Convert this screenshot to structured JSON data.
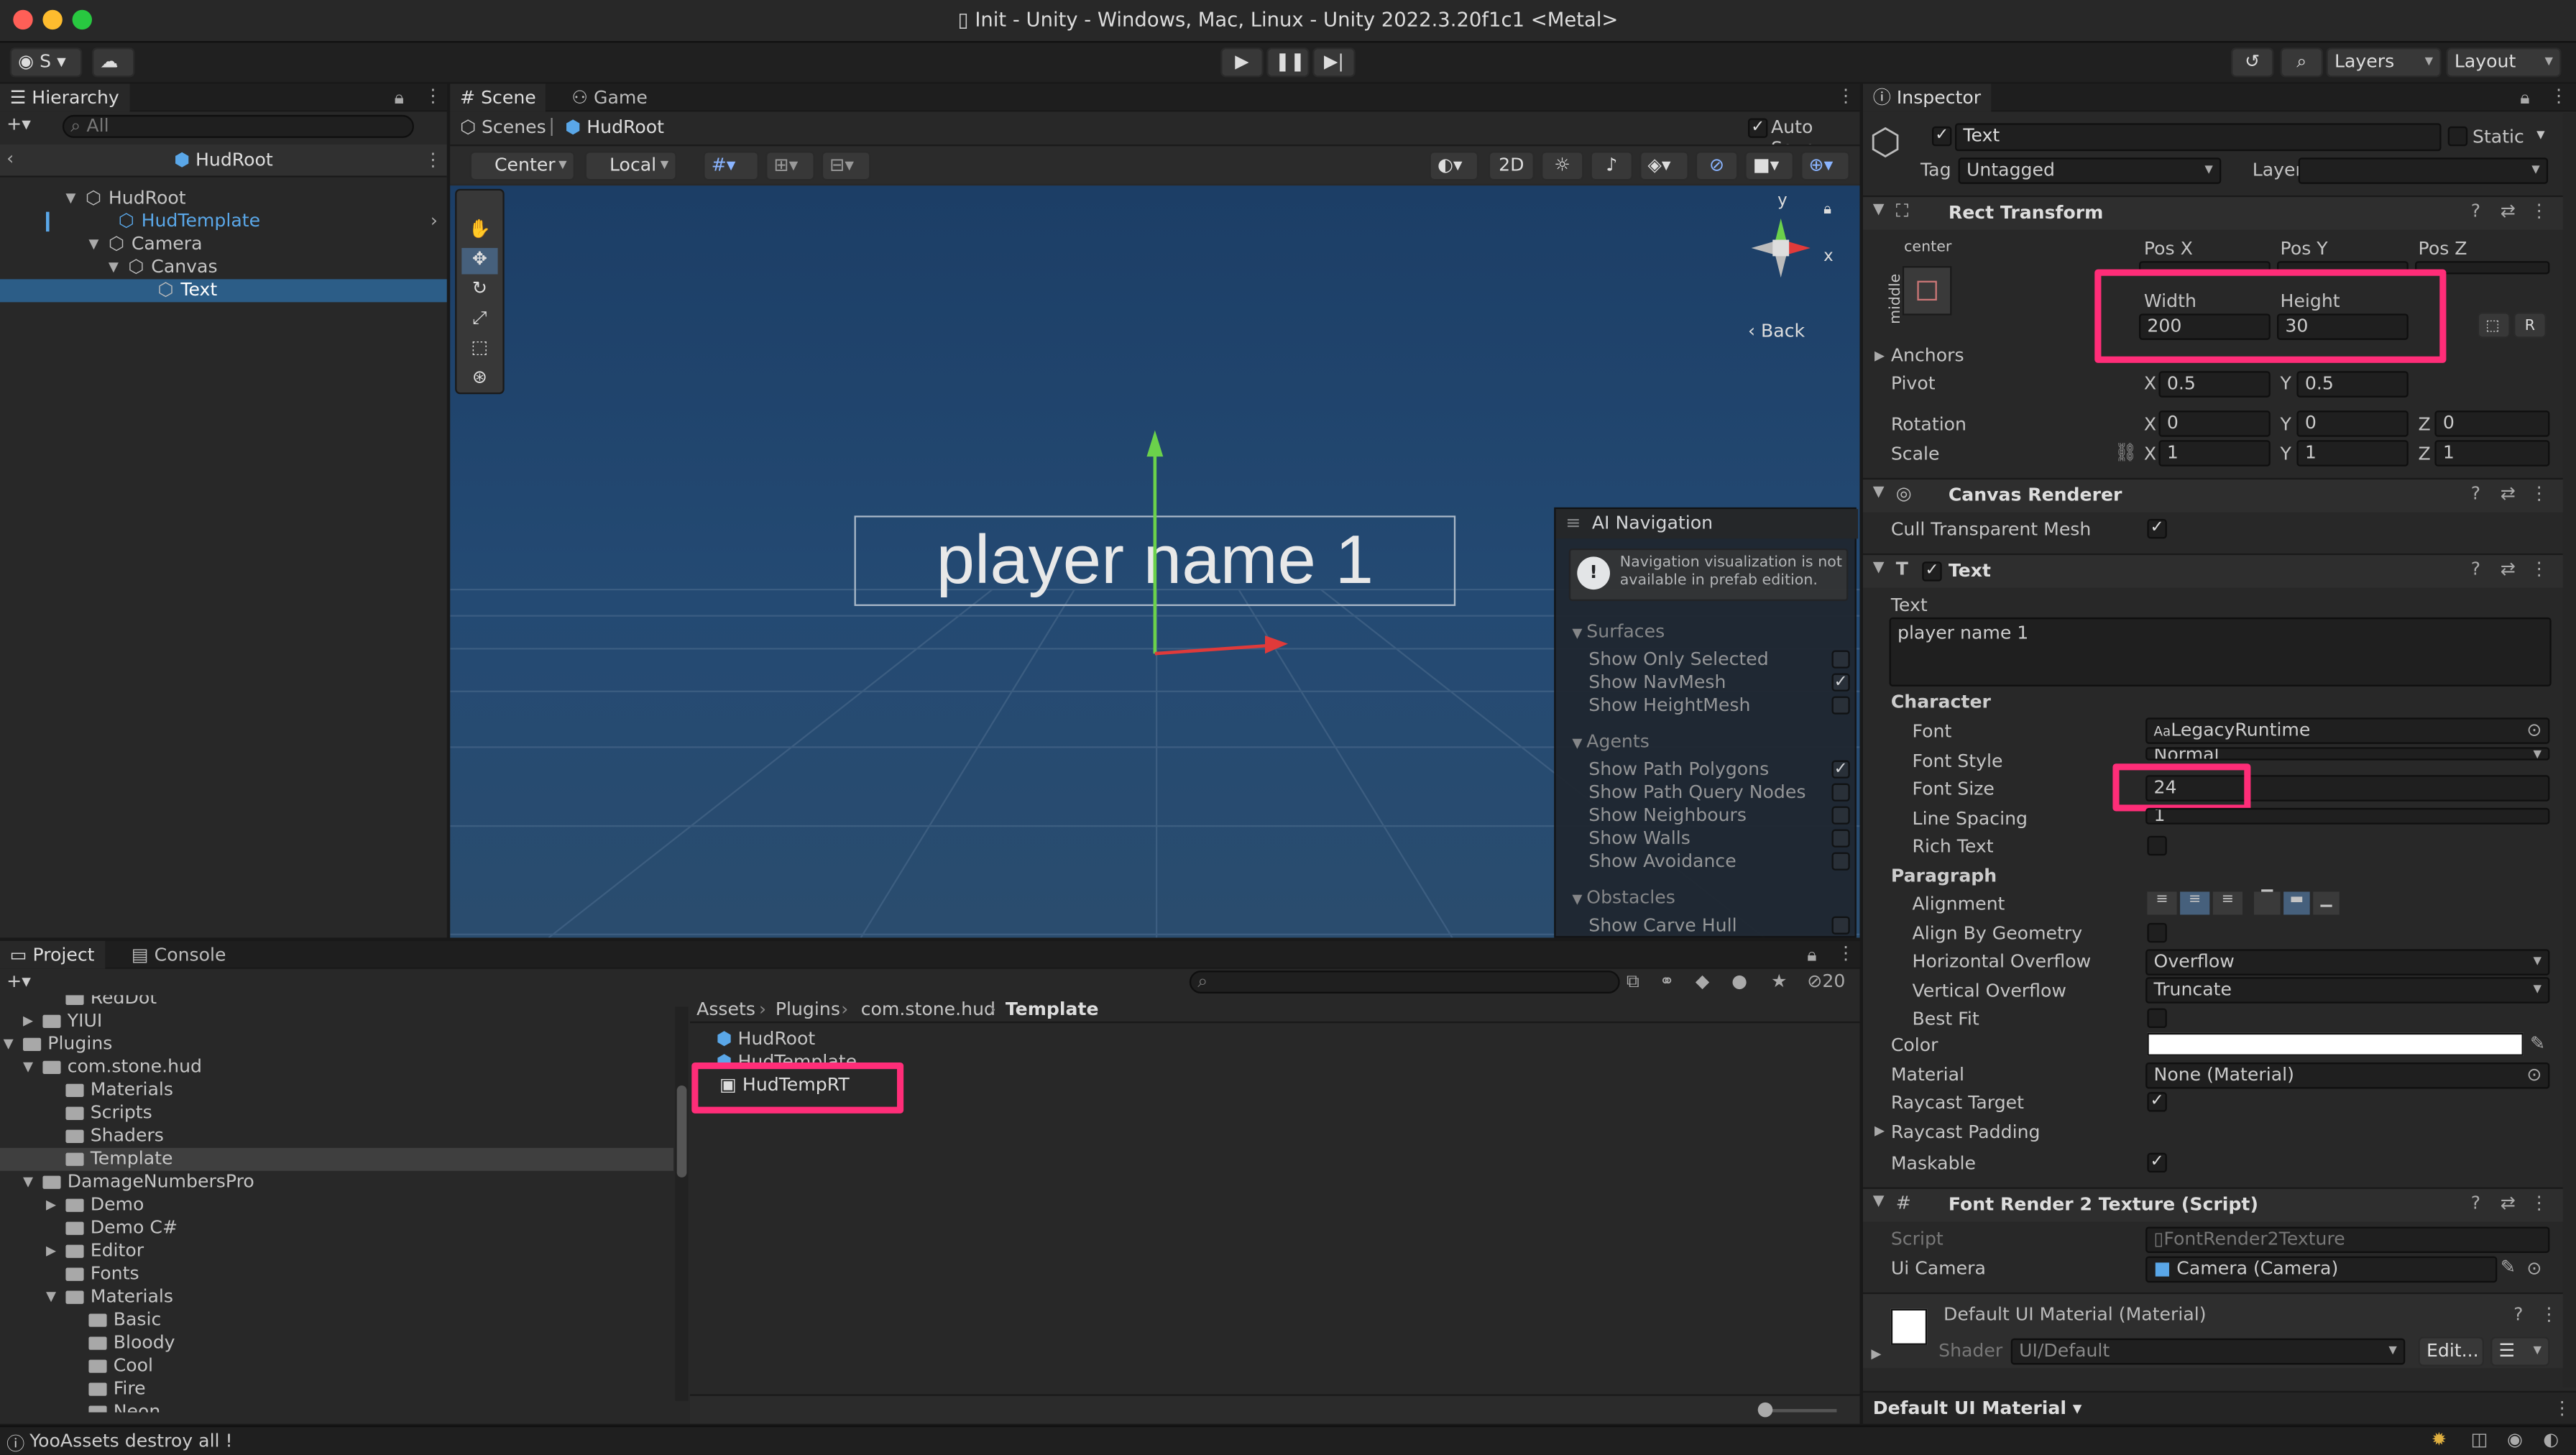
{
  "window": {
    "title": "Init - Unity - Windows, Mac, Linux - Unity 2022.3.20f1c1 <Metal>"
  },
  "toolbar": {
    "account": "S",
    "layers": "Layers",
    "layout": "Layout"
  },
  "hierarchy": {
    "tab": "Hierarchy",
    "search_placeholder": "All",
    "root": "HudRoot",
    "items": [
      {
        "label": "HudRoot"
      },
      {
        "label": "HudTemplate"
      },
      {
        "label": "Camera"
      },
      {
        "label": "Canvas"
      },
      {
        "label": "Text"
      }
    ]
  },
  "scene": {
    "tabs": [
      "Scene",
      "Game"
    ],
    "breadcrumb": [
      "Scenes",
      "HudRoot"
    ],
    "auto_save": "Auto Save",
    "tools": {
      "pivot": "Center",
      "space": "Local",
      "mode_2d": "2D"
    },
    "gizmo": {
      "x": "x",
      "y": "y",
      "back": "Back"
    },
    "text_preview": "player name 1"
  },
  "ai_nav": {
    "title": "AI Navigation",
    "warning": "Navigation visualization is not available in prefab edition.",
    "sections": [
      {
        "title": "Surfaces",
        "items": [
          {
            "label": "Show Only Selected",
            "checked": false
          },
          {
            "label": "Show NavMesh",
            "checked": true
          },
          {
            "label": "Show HeightMesh",
            "checked": false
          }
        ]
      },
      {
        "title": "Agents",
        "items": [
          {
            "label": "Show Path Polygons",
            "checked": true
          },
          {
            "label": "Show Path Query Nodes",
            "checked": false
          },
          {
            "label": "Show Neighbours",
            "checked": false
          },
          {
            "label": "Show Walls",
            "checked": false
          },
          {
            "label": "Show Avoidance",
            "checked": false
          }
        ]
      },
      {
        "title": "Obstacles",
        "items": [
          {
            "label": "Show Carve Hull",
            "checked": false
          }
        ]
      }
    ]
  },
  "project": {
    "tabs": [
      "Project",
      "Console"
    ],
    "tree": [
      {
        "label": "RedDot"
      },
      {
        "label": "YIUI"
      },
      {
        "label": "Plugins"
      },
      {
        "label": "com.stone.hud"
      },
      {
        "label": "Materials"
      },
      {
        "label": "Scripts"
      },
      {
        "label": "Shaders"
      },
      {
        "label": "Template"
      },
      {
        "label": "DamageNumbersPro"
      },
      {
        "label": "Demo"
      },
      {
        "label": "Demo C#"
      },
      {
        "label": "Editor"
      },
      {
        "label": "Fonts"
      },
      {
        "label": "Materials"
      },
      {
        "label": "Basic"
      },
      {
        "label": "Bloody"
      },
      {
        "label": "Cool"
      },
      {
        "label": "Fire"
      },
      {
        "label": "Neon"
      }
    ],
    "path": [
      "Assets",
      "Plugins",
      "com.stone.hud",
      "Template"
    ],
    "assets": [
      "HudRoot",
      "HudTemplate",
      "HudTempRT"
    ],
    "hidden_count": "20"
  },
  "status": {
    "message": "YooAssets destroy all !"
  },
  "inspector": {
    "tab": "Inspector",
    "object_name": "Text",
    "static_label": "Static",
    "tag_label": "Tag",
    "tag_value": "Untagged",
    "layer_label": "Layer",
    "layer_value": "",
    "rect": {
      "title": "Rect Transform",
      "anchor_h": "center",
      "anchor_v": "middle",
      "pos_labels": [
        "Pos X",
        "Pos Y",
        "Pos Z"
      ],
      "width_label": "Width",
      "height_label": "Height",
      "width": "200",
      "height": "30",
      "anchors": "Anchors",
      "pivot": "Pivot",
      "pivot_x": "0.5",
      "pivot_y": "0.5",
      "rotation": "Rotation",
      "rot": [
        "0",
        "0",
        "0"
      ],
      "scale": "Scale",
      "scl": [
        "1",
        "1",
        "1"
      ],
      "axis": [
        "X",
        "Y",
        "Z"
      ],
      "raw_button": "R"
    },
    "canvas_renderer": {
      "title": "Canvas Renderer",
      "cull": "Cull Transparent Mesh",
      "cull_checked": true
    },
    "text": {
      "title": "Text",
      "text_label": "Text",
      "text_value": "player name 1",
      "character": "Character",
      "font_label": "Font",
      "font_value": "LegacyRuntime",
      "font_icon": "Aa",
      "style_label": "Font Style",
      "style_value": "Normal",
      "size_label": "Font Size",
      "size_value": "24",
      "spacing_label": "Line Spacing",
      "spacing_value": "1",
      "rich_label": "Rich Text",
      "paragraph": "Paragraph",
      "alignment": "Alignment",
      "align_geo": "Align By Geometry",
      "h_overflow_label": "Horizontal Overflow",
      "h_overflow": "Overflow",
      "v_overflow_label": "Vertical Overflow",
      "v_overflow": "Truncate",
      "best_fit": "Best Fit",
      "color_label": "Color",
      "color": "#ffffff",
      "material_label": "Material",
      "material_value": "None (Material)",
      "raycast_label": "Raycast Target",
      "raycast_padding": "Raycast Padding",
      "maskable": "Maskable"
    },
    "font_render": {
      "title": "Font Render 2 Texture (Script)",
      "script_label": "Script",
      "script_value": "FontRender2Texture",
      "camera_label": "Ui Camera",
      "camera_value": "Camera (Camera)"
    },
    "material": {
      "title": "Default UI Material (Material)",
      "shader_label": "Shader",
      "shader_value": "UI/Default",
      "edit": "Edit..."
    },
    "footer": "Default UI Material"
  }
}
